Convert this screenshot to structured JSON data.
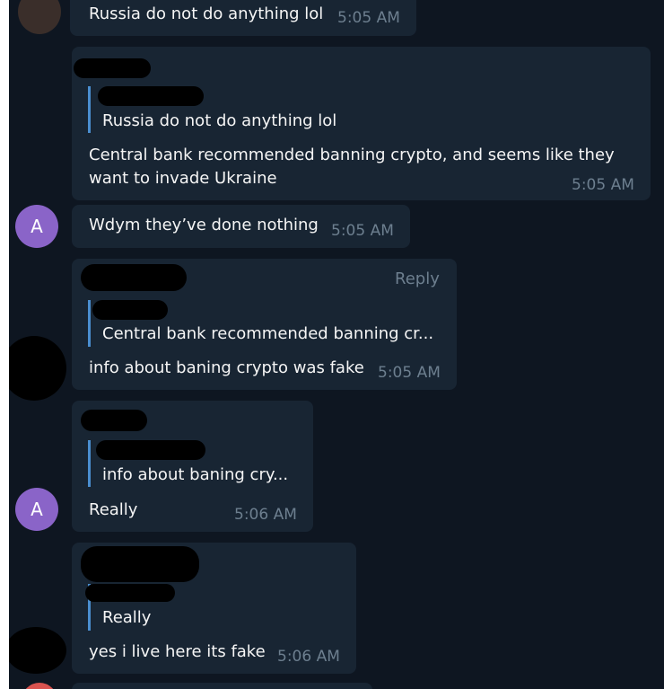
{
  "messages": [
    {
      "text": "Russia do not do anything lol",
      "time": "5:05 AM"
    },
    {
      "quote": "Russia do not do anything lol",
      "text_line1": "Central bank recommended banning crypto, and seems like they",
      "text_line2": "want to invade Ukraine",
      "time": "5:05 AM"
    },
    {
      "avatar_letter": "A",
      "text": "Wdym they’ve done nothing",
      "time": "5:05 AM"
    },
    {
      "reply_label": "Reply",
      "quote": "Central bank recommended banning cr...",
      "text": "info about baning crypto was fake",
      "time": "5:05 AM"
    },
    {
      "avatar_letter": "A",
      "quote": "info about baning cry...",
      "text": "Really",
      "time": "5:06 AM"
    },
    {
      "quote": "Really",
      "text": "yes i live here its fake",
      "time": "5:06 AM"
    }
  ],
  "colors": {
    "background": "#0e1621",
    "bubble": "#182533",
    "quote_bar": "#4a8ecf",
    "avatar": "#8a64c8",
    "timestamp": "#6d7f8f"
  }
}
